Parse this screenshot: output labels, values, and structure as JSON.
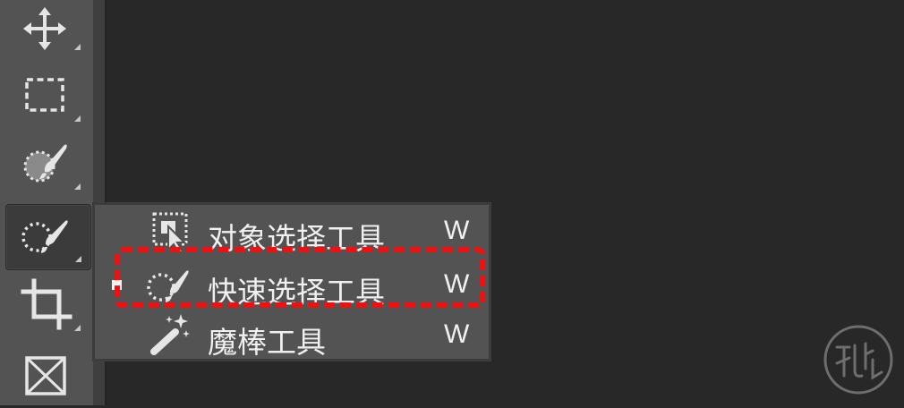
{
  "toolbar": {
    "tools": [
      {
        "name": "move-tool",
        "icon": "move-icon"
      },
      {
        "name": "rectangular-marquee-tool",
        "icon": "rect-marquee-icon"
      },
      {
        "name": "object-selection-group-tool",
        "icon": "select-brush-icon"
      },
      {
        "name": "quick-selection-tool",
        "icon": "quick-selection-icon",
        "active": true
      },
      {
        "name": "crop-tool",
        "icon": "crop-icon"
      },
      {
        "name": "frame-tool",
        "icon": "frame-icon"
      }
    ]
  },
  "flyout": {
    "items": [
      {
        "label": "对象选择工具",
        "shortcut": "W",
        "icon": "object-selection-icon"
      },
      {
        "label": "快速选择工具",
        "shortcut": "W",
        "icon": "quick-selection-icon",
        "current": true
      },
      {
        "label": "魔棒工具",
        "shortcut": "W",
        "icon": "magic-wand-icon"
      }
    ]
  },
  "colors": {
    "canvas": "#282828",
    "panel": "#535353",
    "highlight": "#ee1111"
  }
}
